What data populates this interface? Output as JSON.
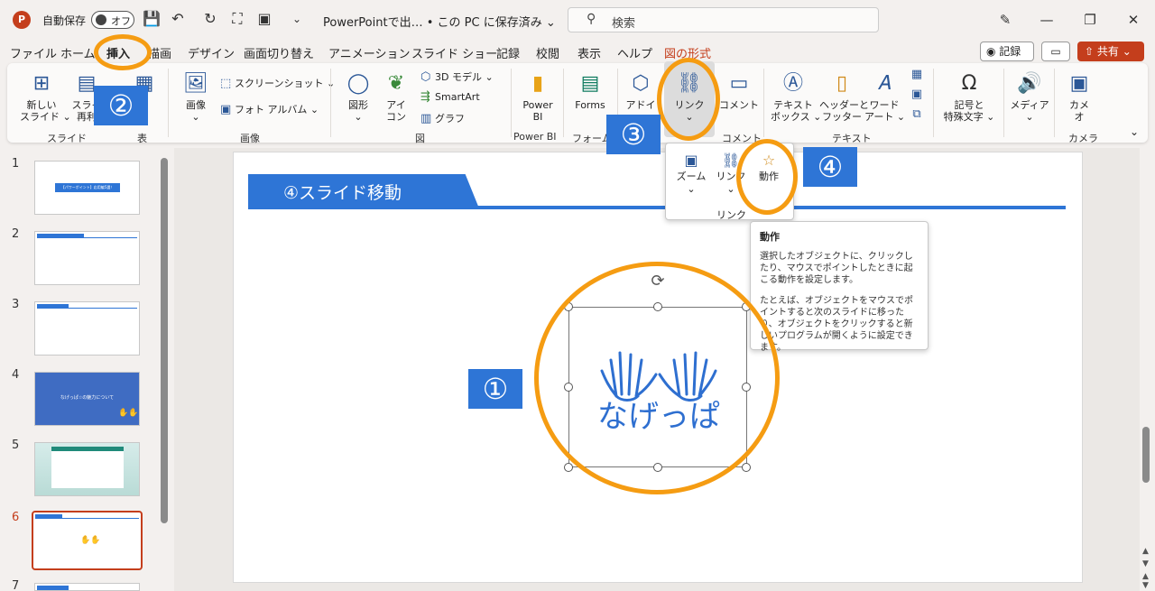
{
  "titlebar": {
    "autosave_label": "自動保存",
    "autosave_state": "オフ",
    "doc_title": "PowerPointで出… • この PC に保存済み ⌄",
    "search_placeholder": "検索"
  },
  "tabs": [
    "ファイル",
    "ホーム",
    "挿入",
    "描画",
    "デザイン",
    "画面切り替え",
    "アニメーション",
    "スライド ショー",
    "記録",
    "校閲",
    "表示",
    "ヘルプ",
    "図の形式"
  ],
  "active_tab": "挿入",
  "right_buttons": {
    "record": "記録",
    "share": "共有"
  },
  "ribbon": {
    "new_slide": "新しい\nスライド ⌄",
    "reuse_slide": "スライ\n再利",
    "table": "",
    "image": "画像\n⌄",
    "screenshot": "スクリーンショット ⌄",
    "photo_album": "フォト アルバム ⌄",
    "shapes": "図形\n⌄",
    "icons": "アイ\nコン",
    "model3d": "3D モデル ⌄",
    "smartart": "SmartArt",
    "graph": "グラフ",
    "powerbi": "Power\nBI",
    "forms": "Forms",
    "addin": "アドイ",
    "link": "リンク\n⌄",
    "comment": "コメント",
    "textbox": "テキスト\nボックス ⌄",
    "header_footer": "ヘッダーと\nフッター",
    "wordart": "ワード\nアート ⌄",
    "symbols": "記号と\n特殊文字 ⌄",
    "media": "メディア\n⌄",
    "camera": "カメ\nオ",
    "groups": {
      "slides": "スライド",
      "table": "表",
      "images": "画像",
      "illustrations": "図",
      "powerbi": "Power BI",
      "forms": "フォーム",
      "comments": "コメント",
      "text": "テキスト",
      "camera": "カメラ"
    }
  },
  "thumbnails": [
    {
      "num": "1",
      "text": "【パワーポイント】応用編5選！"
    },
    {
      "num": "2",
      "text": ""
    },
    {
      "num": "3",
      "text": ""
    },
    {
      "num": "4",
      "text": "なげっぱ☆の魅力について"
    },
    {
      "num": "5",
      "text": ""
    },
    {
      "num": "6",
      "text": ""
    },
    {
      "num": "7",
      "text": ""
    }
  ],
  "selected_slide": "6",
  "slide": {
    "title": "④スライド移動",
    "logo_text": "なげっぱ"
  },
  "link_dropdown": {
    "zoom": "ズーム\n⌄",
    "link": "リンク\n⌄",
    "action": "動作",
    "group_label": "リンク"
  },
  "tooltip": {
    "title": "動作",
    "p1": "選択したオブジェクトに、クリックしたり、マウスでポイントしたときに起こる動作を設定します。",
    "p2": "たとえば、オブジェクトをマウスでポイントすると次のスライドに移ったり、オブジェクトをクリックすると新しいプログラムが開くように設定できます。"
  },
  "badges": [
    "①",
    "②",
    "③",
    "④"
  ],
  "colors": {
    "accent": "#c43e1c",
    "slide_blue": "#2e75d6",
    "highlight_ring": "#f59c12"
  }
}
